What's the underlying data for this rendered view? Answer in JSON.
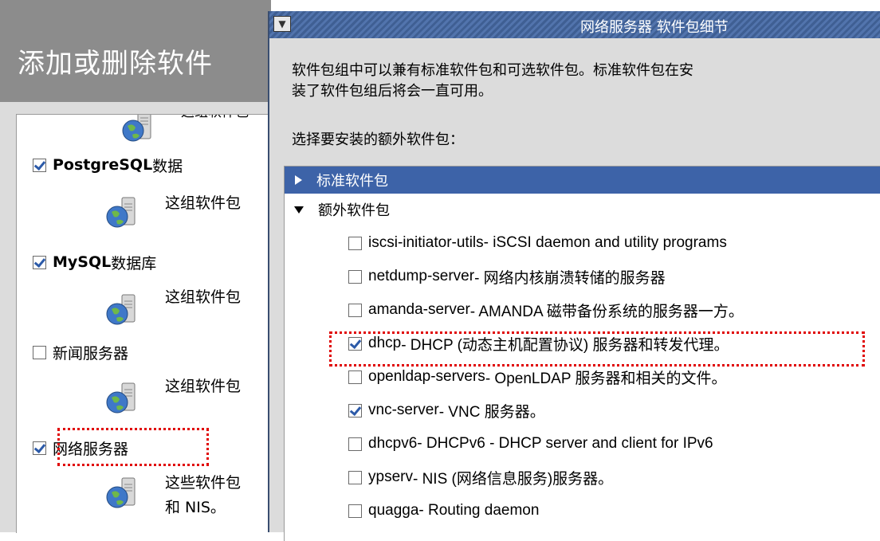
{
  "background_window": {
    "title": "添加或删除软件",
    "partial_top_text": "这组软件包",
    "groups": [
      {
        "label_bold": "PostgreSQL",
        "label_rest": " 数据",
        "checked": true,
        "desc": "这组软件包"
      },
      {
        "label_bold": "MySQL",
        "label_rest": " 数据库",
        "checked": true,
        "desc": "这组软件包"
      },
      {
        "label_bold": "",
        "label_rest": "新闻服务器",
        "checked": false,
        "desc": "这组软件包"
      },
      {
        "label_bold": "",
        "label_rest": "网络服务器",
        "checked": true,
        "desc": "这些软件包",
        "desc2": "和 NIS。"
      }
    ],
    "icon": "server-globe-icon"
  },
  "dialog": {
    "menu_icon": "chevron-down-icon",
    "title": "网络服务器 软件包细节",
    "description_line1": "软件包组中可以兼有标准软件包和可选软件包。标准软件包在安",
    "description_line2": "装了软件包组后将会一直可用。",
    "prompt": "选择要安装的额外软件包：",
    "standard_label": "标准软件包",
    "extra_label": "额外软件包",
    "packages": [
      {
        "name": "iscsi-initiator-utils",
        "desc": " - iSCSI daemon and utility programs",
        "checked": false
      },
      {
        "name": "netdump-server",
        "desc": " - 网络内核崩溃转储的服务器",
        "checked": false
      },
      {
        "name": "amanda-server",
        "desc": " - AMANDA 磁带备份系统的服务器一方。",
        "checked": false
      },
      {
        "name": "dhcp",
        "desc": " - DHCP (动态主机配置协议) 服务器和转发代理。",
        "checked": true
      },
      {
        "name": "openldap-servers",
        "desc": " - OpenLDAP 服务器和相关的文件。",
        "checked": false
      },
      {
        "name": "vnc-server",
        "desc": " - VNC 服务器。",
        "checked": true
      },
      {
        "name": "dhcpv6",
        "desc": " - DHCPv6 - DHCP server and client for IPv6",
        "checked": false
      },
      {
        "name": "ypserv",
        "desc": " - NIS (网络信息服务)服务器。",
        "checked": false
      },
      {
        "name": "quagga",
        "desc": " - Routing daemon",
        "checked": false
      }
    ]
  },
  "colors": {
    "highlight_border": "#e00000",
    "selection_bg": "#3d63a8",
    "titlebar": "#4a6ba3",
    "check": "#2c5aa8"
  }
}
